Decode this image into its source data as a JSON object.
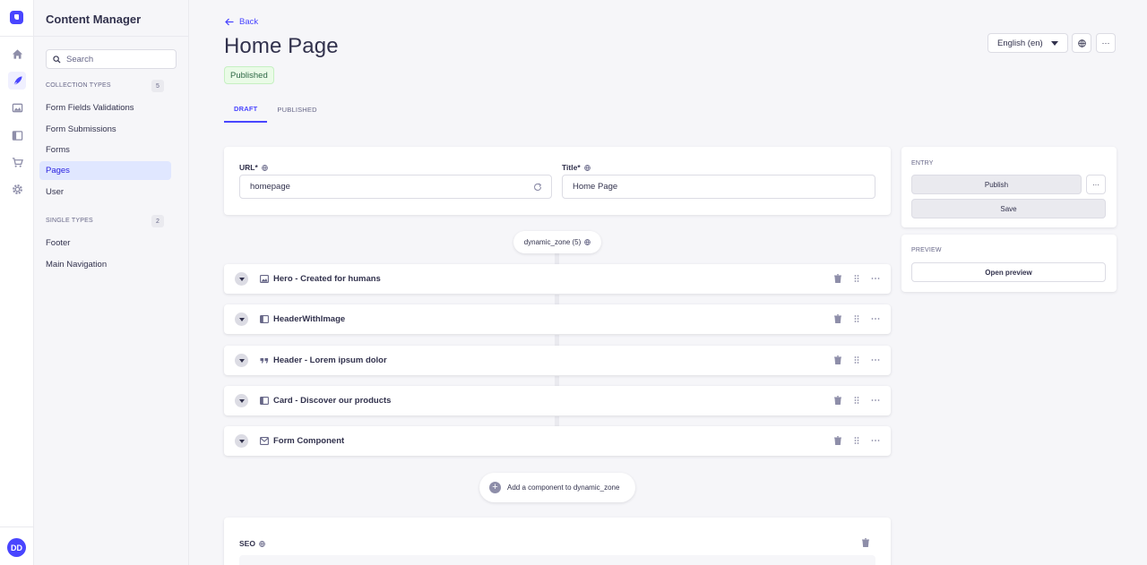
{
  "rail": {
    "icons": [
      "home-icon",
      "content-manager-icon",
      "media-library-icon",
      "content-type-builder-icon",
      "marketplace-icon",
      "settings-icon"
    ],
    "user_initials": "DD",
    "accent": "#4945ff"
  },
  "subnav": {
    "title": "Content Manager",
    "search_placeholder": "Search",
    "collection_types_label": "COLLECTION TYPES",
    "collection_types_count": "5",
    "collection_types": [
      "Form Fields Validations",
      "Form Submissions",
      "Forms",
      "Pages",
      "User"
    ],
    "active_item": "Pages",
    "single_types_label": "SINGLE TYPES",
    "single_types_count": "2",
    "single_types": [
      "Footer",
      "Main Navigation"
    ]
  },
  "header": {
    "back_label": "Back",
    "title": "Home Page",
    "status": "Published",
    "locale": "English (en)",
    "more_label": "···"
  },
  "tabs": [
    "DRAFT",
    "PUBLISHED"
  ],
  "fields": {
    "url_label": "URL*",
    "url_value": "homepage",
    "title_label": "Title*",
    "title_value": "Home Page"
  },
  "dynamic_zone": {
    "label": "dynamic_zone (5)",
    "components": [
      {
        "label": "Hero - Created for humans",
        "icon": "image-icon"
      },
      {
        "label": "HeaderWithImage",
        "icon": "layout-icon"
      },
      {
        "label": "Header - Lorem ipsum dolor",
        "icon": "quote-icon"
      },
      {
        "label": "Card - Discover our products",
        "icon": "layout-icon"
      },
      {
        "label": "Form Component",
        "icon": "envelope-icon"
      }
    ],
    "add_label": "Add a component to dynamic_zone"
  },
  "seo": {
    "label": "SEO"
  },
  "entry": {
    "label": "ENTRY",
    "publish_label": "Publish",
    "save_label": "Save",
    "more_label": "···"
  },
  "preview": {
    "label": "PREVIEW",
    "open_label": "Open preview"
  }
}
